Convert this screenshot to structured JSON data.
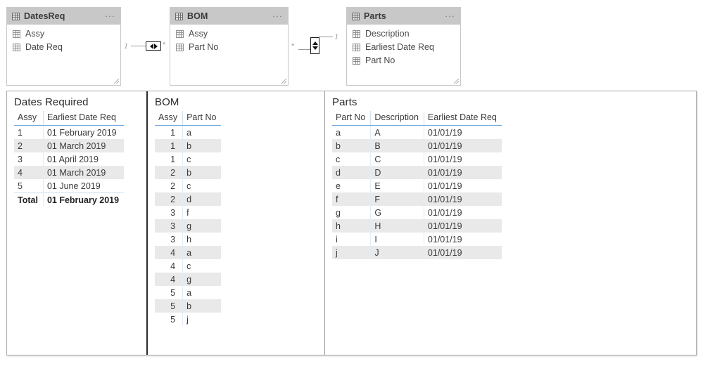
{
  "model_diagram": {
    "tables": [
      {
        "name": "DatesReq",
        "menu": "...",
        "icon": "table-icon",
        "fields": [
          {
            "label": "Assy",
            "icon": "column-icon"
          },
          {
            "label": "Date Req",
            "icon": "column-icon"
          }
        ]
      },
      {
        "name": "BOM",
        "menu": "...",
        "icon": "table-icon",
        "fields": [
          {
            "label": "Assy",
            "icon": "column-icon"
          },
          {
            "label": "Part No",
            "icon": "column-icon"
          }
        ]
      },
      {
        "name": "Parts",
        "menu": "...",
        "icon": "table-icon",
        "fields": [
          {
            "label": "Description",
            "icon": "column-icon"
          },
          {
            "label": "Earliest Date Req",
            "icon": "column-icon"
          },
          {
            "label": "Part No",
            "icon": "column-icon"
          }
        ]
      }
    ],
    "relationships": [
      {
        "from_cardinality": "1",
        "to_cardinality": "*",
        "cross_filter": "both",
        "direction_icon": "left-right-arrows-icon"
      },
      {
        "from_cardinality": "*",
        "to_cardinality": "1",
        "cross_filter": "both",
        "direction_icon": "up-down-arrows-icon"
      }
    ]
  },
  "report": {
    "panels": [
      {
        "title": "Dates Required",
        "columns": [
          "Assy",
          "Earliest Date Req"
        ],
        "rows": [
          [
            "1",
            "01 February 2019"
          ],
          [
            "2",
            "01 March 2019"
          ],
          [
            "3",
            "01 April 2019"
          ],
          [
            "4",
            "01 March 2019"
          ],
          [
            "5",
            "01 June 2019"
          ]
        ],
        "total_row": [
          "Total",
          "01 February 2019"
        ]
      },
      {
        "title": "BOM",
        "columns": [
          "Assy",
          "Part No"
        ],
        "rows": [
          [
            "1",
            "a"
          ],
          [
            "1",
            "b"
          ],
          [
            "1",
            "c"
          ],
          [
            "2",
            "b"
          ],
          [
            "2",
            "c"
          ],
          [
            "2",
            "d"
          ],
          [
            "3",
            "f"
          ],
          [
            "3",
            "g"
          ],
          [
            "3",
            "h"
          ],
          [
            "4",
            "a"
          ],
          [
            "4",
            "c"
          ],
          [
            "4",
            "g"
          ],
          [
            "5",
            "a"
          ],
          [
            "5",
            "b"
          ],
          [
            "5",
            "j"
          ]
        ]
      },
      {
        "title": "Parts",
        "columns": [
          "Part No",
          "Description",
          "Earliest Date Req"
        ],
        "rows": [
          [
            "a",
            "A",
            "01/01/19"
          ],
          [
            "b",
            "B",
            "01/01/19"
          ],
          [
            "c",
            "C",
            "01/01/19"
          ],
          [
            "d",
            "D",
            "01/01/19"
          ],
          [
            "e",
            "E",
            "01/01/19"
          ],
          [
            "f",
            "F",
            "01/01/19"
          ],
          [
            "g",
            "G",
            "01/01/19"
          ],
          [
            "h",
            "H",
            "01/01/19"
          ],
          [
            "i",
            "I",
            "01/01/19"
          ],
          [
            "j",
            "J",
            "01/01/19"
          ]
        ]
      }
    ]
  },
  "colors": {
    "card_header": "#c8c8c8",
    "header_underline": "#6fa8dc",
    "row_stripe": "#e9e9e9",
    "panel_border": "#adadad"
  }
}
